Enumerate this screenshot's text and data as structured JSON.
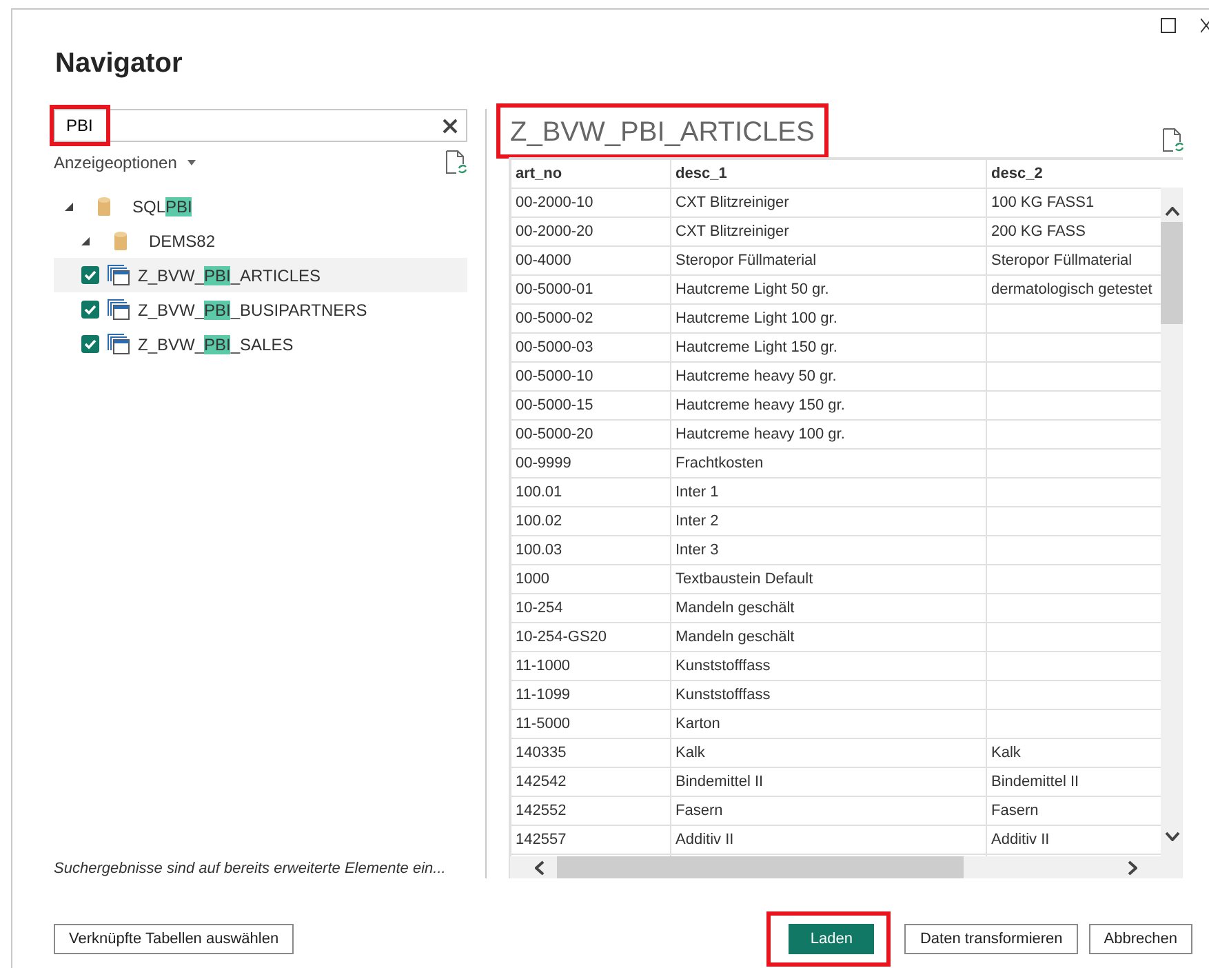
{
  "window": {
    "title": "Navigator"
  },
  "search": {
    "value": "PBI",
    "highlighted": true
  },
  "display_options": {
    "label": "Anzeigeoptionen"
  },
  "tree": [
    {
      "label": {
        "before": "SQL",
        "match": "PBI"
      },
      "kind": "database",
      "expanded": true,
      "children": [
        {
          "label": {
            "before": "DEMS82"
          },
          "kind": "database",
          "expanded": true,
          "children": [
            {
              "label": {
                "before": "Z_BVW_",
                "match": "PBI",
                "after": "_ARTICLES"
              },
              "kind": "table",
              "checked": true,
              "selected": true
            },
            {
              "label": {
                "before": "Z_BVW_",
                "match": "PBI",
                "after": "_BUSIPARTNERS"
              },
              "kind": "table",
              "checked": true,
              "selected": false
            },
            {
              "label": {
                "before": "Z_BVW_",
                "match": "PBI",
                "after": "_SALES"
              },
              "kind": "table",
              "checked": true,
              "selected": false
            }
          ]
        }
      ]
    }
  ],
  "footnote": "Suchergebnisse sind auf bereits erweiterte Elemente ein...",
  "preview": {
    "title": "Z_BVW_PBI_ARTICLES",
    "highlighted": true,
    "columns": [
      "art_no",
      "desc_1",
      "desc_2"
    ],
    "rows": [
      [
        "00-2000-10",
        "CXT Blitzreiniger",
        "100 KG FASS1"
      ],
      [
        "00-2000-20",
        "CXT Blitzreiniger",
        "200 KG FASS"
      ],
      [
        "00-4000",
        "Steropor Füllmaterial",
        "Steropor Füllmaterial"
      ],
      [
        "00-5000-01",
        "Hautcreme Light 50 gr.",
        "dermatologisch getestet"
      ],
      [
        "00-5000-02",
        "Hautcreme Light 100 gr."
      ],
      [
        "00-5000-03",
        "Hautcreme Light 150 gr."
      ],
      [
        "00-5000-10",
        "Hautcreme heavy 50 gr."
      ],
      [
        "00-5000-15",
        "Hautcreme heavy 150 gr."
      ],
      [
        "00-5000-20",
        "Hautcreme heavy 100 gr."
      ],
      [
        "00-9999",
        "Frachtkosten"
      ],
      [
        "100.01",
        "Inter 1"
      ],
      [
        "100.02",
        "Inter 2"
      ],
      [
        "100.03",
        "Inter 3"
      ],
      [
        "1000",
        "Textbaustein Default"
      ],
      [
        "10-254",
        "Mandeln geschält"
      ],
      [
        "10-254-GS20",
        "Mandeln geschält"
      ],
      [
        "11-1000",
        "Kunststofffass"
      ],
      [
        "11-1099",
        "Kunststofffass"
      ],
      [
        "11-5000",
        "Karton"
      ],
      [
        "140335",
        "Kalk",
        "Kalk"
      ],
      [
        "142542",
        "Bindemittel II",
        "Bindemittel II"
      ],
      [
        "142552",
        "Fasern",
        "Fasern"
      ],
      [
        "142557",
        "Additiv II",
        "Additiv II"
      ]
    ]
  },
  "buttons": [
    {
      "label": "Verknüpfte Tabellen auswählen",
      "kind": "secondary",
      "highlighted": false
    },
    {
      "label": "Laden",
      "kind": "primary",
      "highlighted": true
    },
    {
      "label": "Daten transformieren",
      "kind": "secondary",
      "highlighted": false
    },
    {
      "label": "Abbrechen",
      "kind": "secondary",
      "highlighted": false
    }
  ]
}
